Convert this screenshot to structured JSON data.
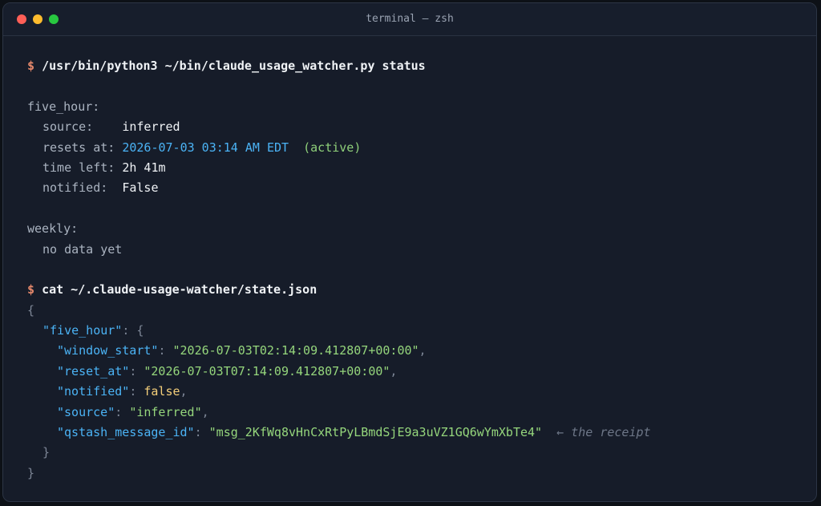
{
  "window": {
    "title": "terminal — zsh"
  },
  "prompt_symbol": "$",
  "commands": [
    "/usr/bin/python3 ~/bin/claude_usage_watcher.py status",
    "cat ~/.claude-usage-watcher/state.json"
  ],
  "status": {
    "five_hour_heading": "five_hour:",
    "source_label": "source:",
    "source_value": "inferred",
    "resets_label": "resets at:",
    "resets_value": "2026-07-03 03:14 AM EDT",
    "resets_state": "(active)",
    "time_left_label": "time left:",
    "time_left_value": "2h 41m",
    "notified_label": "notified:",
    "notified_value": "False",
    "weekly_heading": "weekly:",
    "weekly_value": "no data yet"
  },
  "json_output": {
    "open_brace": "{",
    "five_hour_key": "\"five_hour\"",
    "inner_open": ": {",
    "inner_close": "}",
    "close_brace": "}",
    "fields": [
      {
        "key": "\"window_start\"",
        "value": "\"2026-07-03T02:14:09.412807+00:00\"",
        "kind": "str",
        "trail": ","
      },
      {
        "key": "\"reset_at\"",
        "value": "\"2026-07-03T07:14:09.412807+00:00\"",
        "kind": "str",
        "trail": ","
      },
      {
        "key": "\"notified\"",
        "value": "false",
        "kind": "kw",
        "trail": ","
      },
      {
        "key": "\"source\"",
        "value": "\"inferred\"",
        "kind": "str",
        "trail": ","
      },
      {
        "key": "\"qstash_message_id\"",
        "value": "\"msg_2KfWq8vHnCxRtPyLBmdSjE9a3uVZ1GQ6wYmXbTe4\"",
        "kind": "str",
        "trail": ""
      }
    ],
    "annotation": "← the receipt"
  },
  "colors": {
    "background": "#161c29",
    "prompt": "#e5886b",
    "json_key": "#4bb3f5",
    "json_string": "#95d67c",
    "json_bool": "#f5cf7a",
    "active": "#8fd07a"
  }
}
